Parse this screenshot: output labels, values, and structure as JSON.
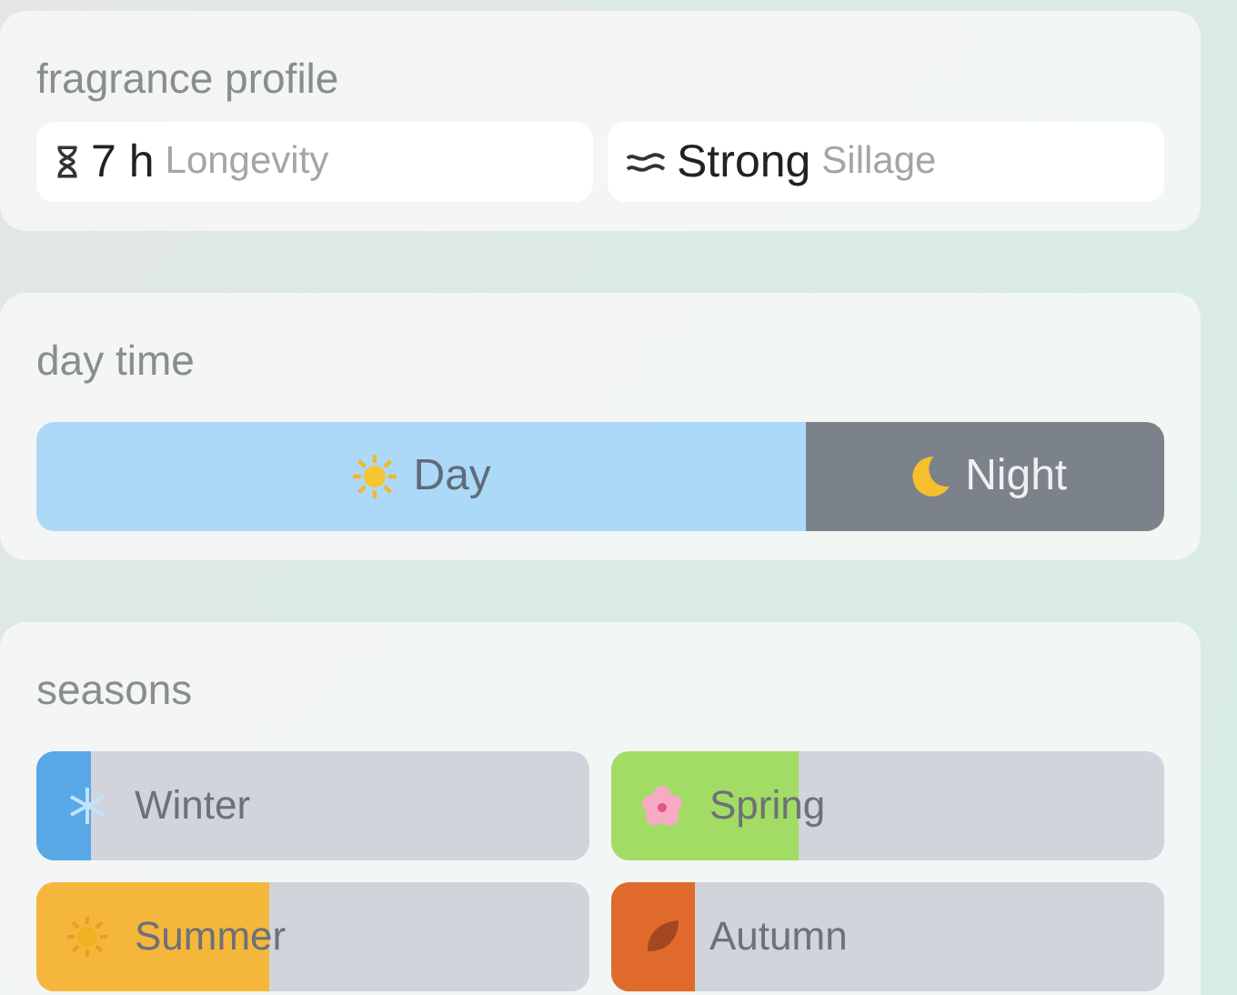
{
  "profile": {
    "title": "fragrance profile",
    "stats": [
      {
        "kind": "longevity",
        "value": "7 h",
        "label": "Longevity"
      },
      {
        "kind": "sillage",
        "value": "Strong",
        "label": "Sillage"
      }
    ]
  },
  "day_time": {
    "title": "day time",
    "segments": [
      {
        "kind": "day",
        "label": "Day",
        "selected": true
      },
      {
        "kind": "night",
        "label": "Night",
        "selected": false
      }
    ]
  },
  "seasons": {
    "title": "seasons",
    "items": [
      {
        "kind": "winter",
        "label": "Winter",
        "level": 0.1,
        "color": "#5aa7e6"
      },
      {
        "kind": "spring",
        "label": "Spring",
        "level": 0.34,
        "color": "#a3dc64"
      },
      {
        "kind": "summer",
        "label": "Summer",
        "level": 0.42,
        "color": "#f4b73c"
      },
      {
        "kind": "autumn",
        "label": "Autumn",
        "level": 0.15,
        "color": "#e06a2c"
      }
    ]
  }
}
